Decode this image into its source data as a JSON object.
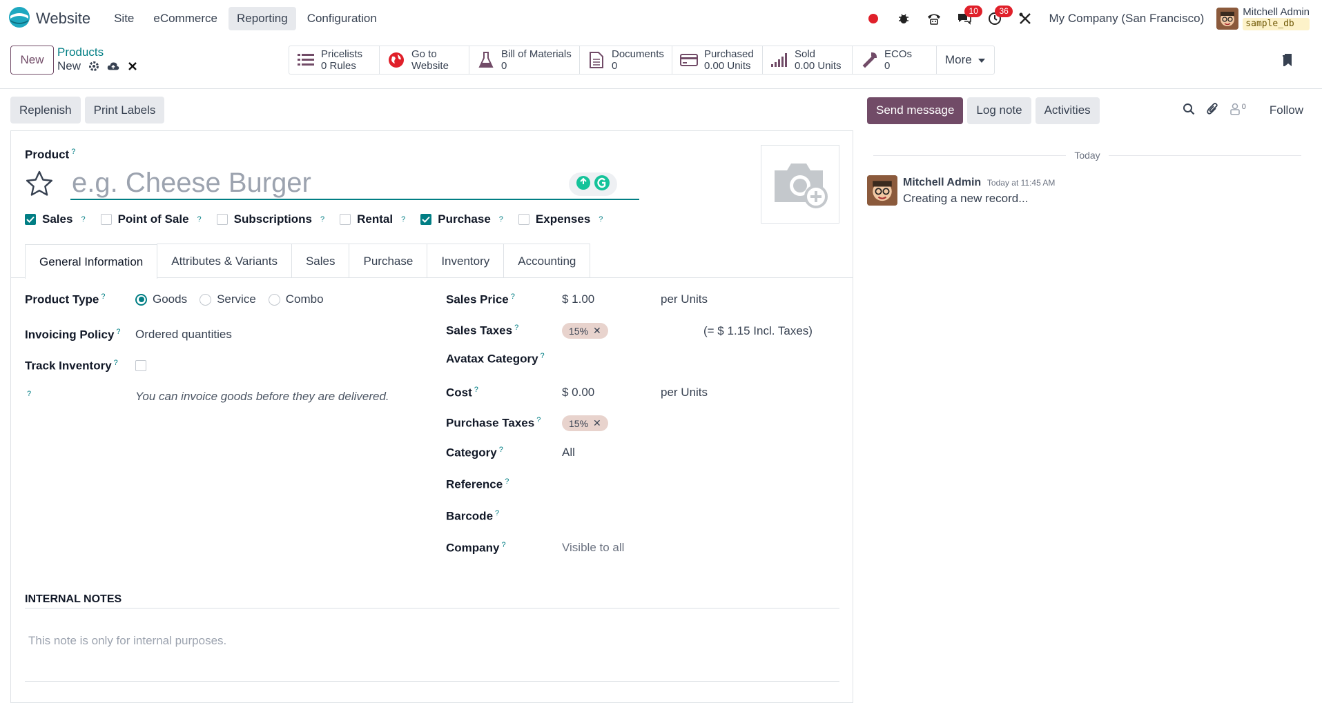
{
  "nav": {
    "app_name": "Website",
    "menu": [
      "Site",
      "eCommerce",
      "Reporting",
      "Configuration"
    ],
    "badges": {
      "messages": "10",
      "activities": "36"
    },
    "company": "My Company (San Francisco)",
    "user_name": "Mitchell Admin",
    "db_name": "sample_db"
  },
  "control": {
    "new_label": "New",
    "breadcrumb_parent": "Products",
    "breadcrumb_current": "New",
    "smart_buttons": [
      {
        "line1": "Pricelists",
        "line2": "0 Rules"
      },
      {
        "line1": "Go to",
        "line2": "Website"
      },
      {
        "line1": "Bill of Materials",
        "line2": "0"
      },
      {
        "line1": "Documents",
        "line2": "0"
      },
      {
        "line1": "Purchased",
        "line2": "0.00 Units"
      },
      {
        "line1": "Sold",
        "line2": "0.00 Units"
      },
      {
        "line1": "ECOs",
        "line2": "0"
      }
    ],
    "more_label": "More"
  },
  "actions": {
    "replenish": "Replenish",
    "print_labels": "Print Labels"
  },
  "form": {
    "product_label": "Product",
    "name_placeholder": "e.g. Cheese Burger",
    "checkboxes": [
      {
        "label": "Sales",
        "checked": true
      },
      {
        "label": "Point of Sale",
        "checked": false
      },
      {
        "label": "Subscriptions",
        "checked": false
      },
      {
        "label": "Rental",
        "checked": false
      },
      {
        "label": "Purchase",
        "checked": true
      },
      {
        "label": "Expenses",
        "checked": false
      }
    ],
    "tabs": [
      "General Information",
      "Attributes & Variants",
      "Sales",
      "Purchase",
      "Inventory",
      "Accounting"
    ],
    "left": {
      "product_type_label": "Product Type",
      "product_type_options": [
        "Goods",
        "Service",
        "Combo"
      ],
      "product_type_selected": "Goods",
      "invoicing_policy_label": "Invoicing Policy",
      "invoicing_policy_value": "Ordered quantities",
      "track_inventory_label": "Track Inventory",
      "hint": "You can invoice goods before they are delivered."
    },
    "right": {
      "sales_price_label": "Sales Price",
      "sales_price_value": "$ 1.00",
      "sales_price_unit": "per Units",
      "sales_taxes_label": "Sales Taxes",
      "sales_taxes_tag": "15%",
      "sales_taxes_incl": "(= $ 1.15 Incl. Taxes)",
      "avatax_label": "Avatax Category",
      "cost_label": "Cost",
      "cost_value": "$ 0.00",
      "cost_unit": "per Units",
      "purchase_taxes_label": "Purchase Taxes",
      "purchase_taxes_tag": "15%",
      "category_label": "Category",
      "category_value": "All",
      "reference_label": "Reference",
      "barcode_label": "Barcode",
      "company_label": "Company",
      "company_placeholder": "Visible to all"
    },
    "internal_notes_label": "INTERNAL NOTES",
    "internal_notes_placeholder": "This note is only for internal purposes."
  },
  "chatter": {
    "send_message": "Send message",
    "log_note": "Log note",
    "activities": "Activities",
    "follower_count": "0",
    "follow": "Follow",
    "today": "Today",
    "message": {
      "author": "Mitchell Admin",
      "time": "Today at 11:45 AM",
      "body": "Creating a new record..."
    }
  },
  "colors": {
    "primary": "#714b67",
    "accent": "#017e84",
    "badge": "#e0202a"
  }
}
